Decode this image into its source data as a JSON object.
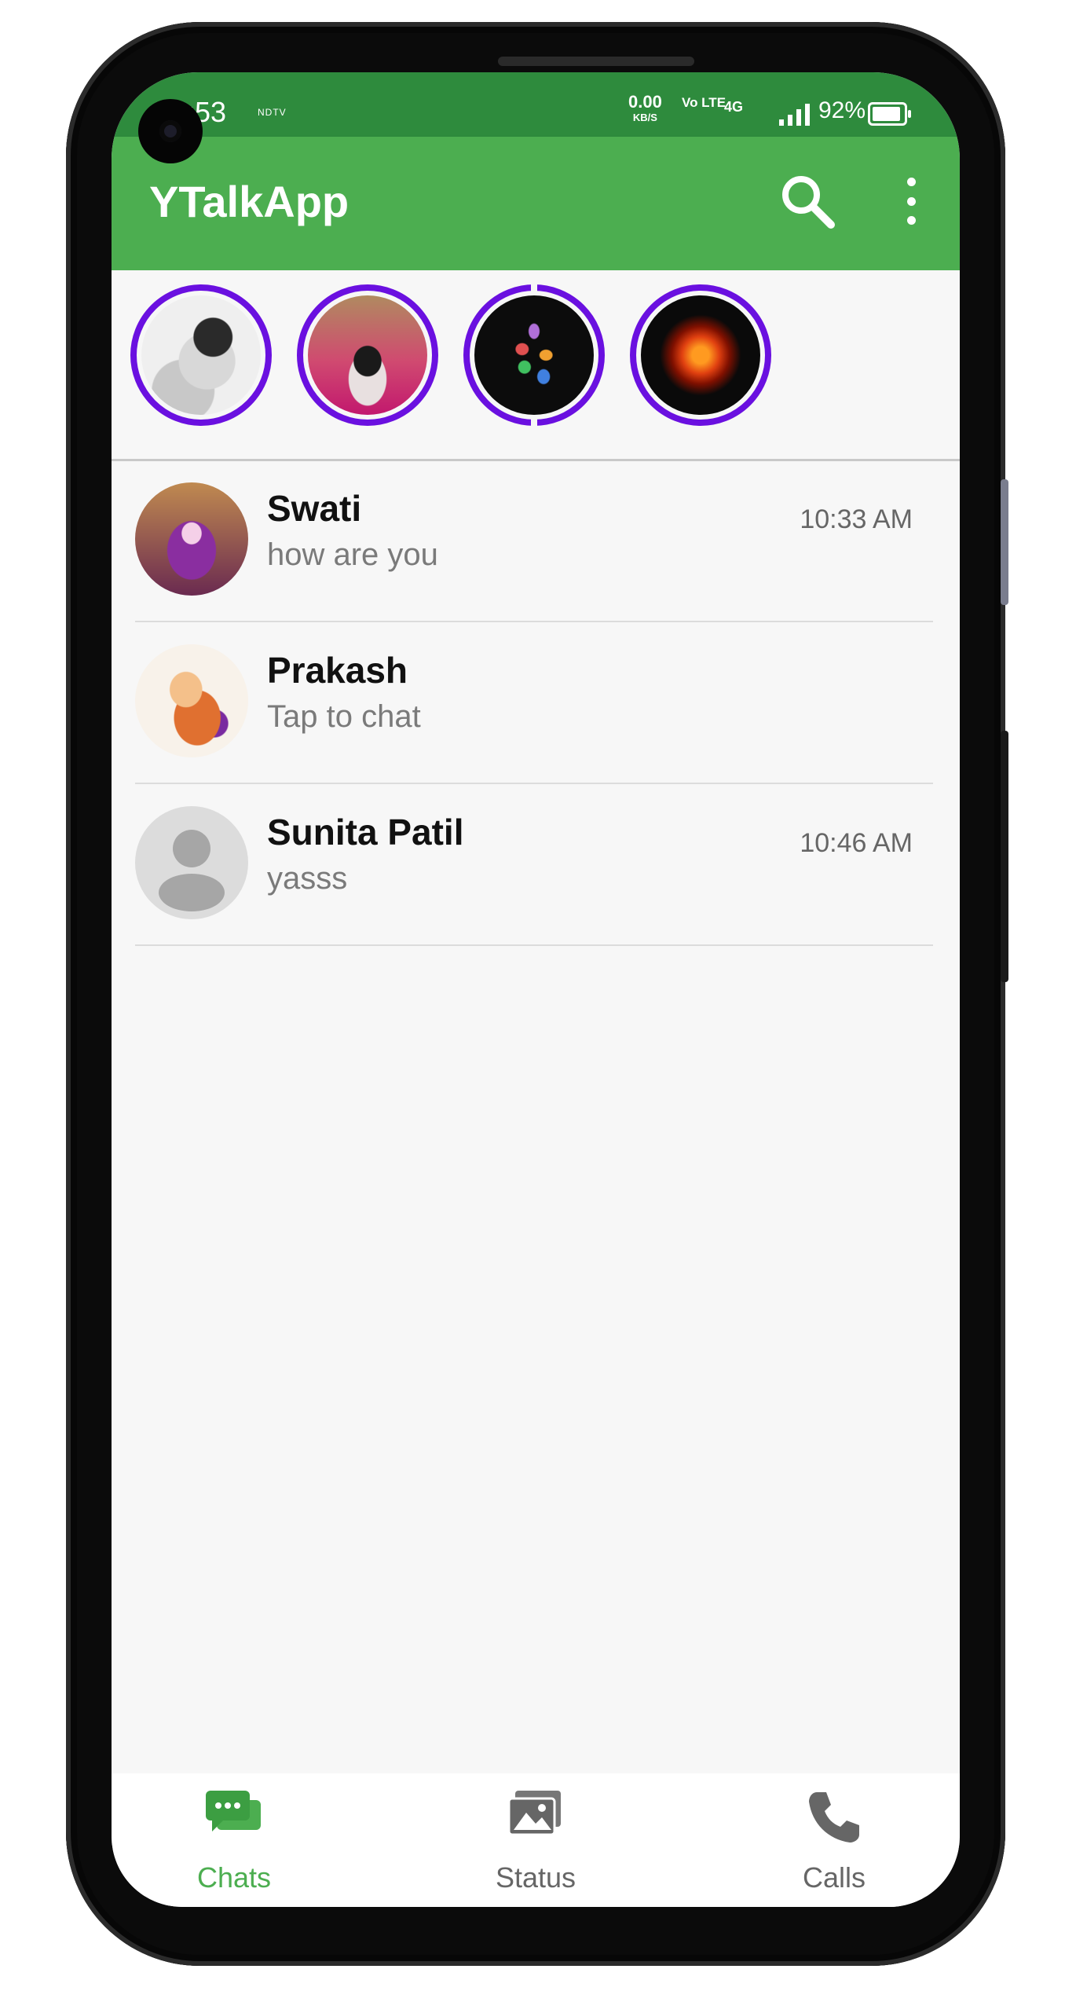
{
  "status_bar": {
    "time": "9:53",
    "left_icon": "NDTV",
    "net_speed": "0.00",
    "net_speed_unit": "KB/S",
    "volte": "Vo LTE",
    "network": "4G",
    "battery": "92%",
    "battery_level_percent": 92
  },
  "app_bar": {
    "title": "YTalkApp",
    "search_icon": "search-icon",
    "menu_icon": "more-vert-icon"
  },
  "stories": [
    {
      "name": "story-1"
    },
    {
      "name": "story-2"
    },
    {
      "name": "story-3"
    },
    {
      "name": "story-4"
    }
  ],
  "chats": [
    {
      "name": "Swati",
      "message": "how are you",
      "time": "10:33 AM"
    },
    {
      "name": "Prakash",
      "message": "Tap to chat",
      "time": ""
    },
    {
      "name": "Sunita Patil",
      "message": "yasss",
      "time": "10:46 AM"
    }
  ],
  "bottom_nav": {
    "chats": "Chats",
    "status": "Status",
    "calls": "Calls",
    "active": "Chats"
  },
  "colors": {
    "status_bar": "#2e8b3d",
    "app_bar": "#4cae50",
    "story_ring": "#6a10e0",
    "active_tab": "#4cae50",
    "inactive_tab": "#666666"
  }
}
